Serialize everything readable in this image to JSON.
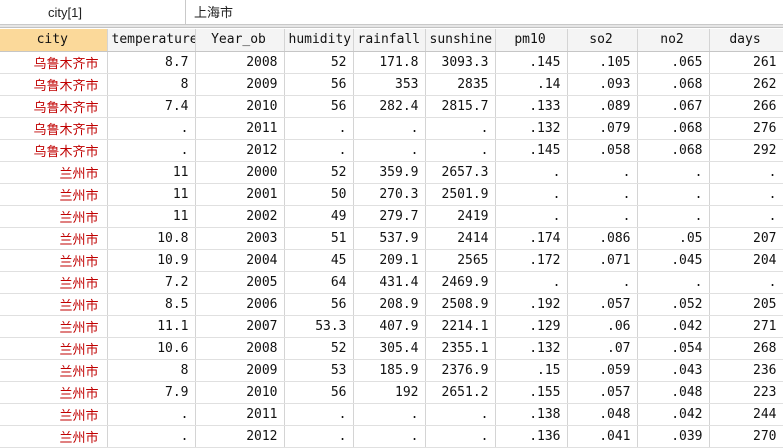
{
  "toolbar": {
    "cell_ref": "city[1]",
    "cell_value": "上海市"
  },
  "columns": [
    "city",
    "temperature",
    "Year_ob",
    "humidity",
    "rainfall",
    "sunshine",
    "pm10",
    "so2",
    "no2",
    "days"
  ],
  "rows": [
    [
      "乌鲁木齐市",
      "8.7",
      "2008",
      "52",
      "171.8",
      "3093.3",
      ".145",
      ".105",
      ".065",
      "261"
    ],
    [
      "乌鲁木齐市",
      "8",
      "2009",
      "56",
      "353",
      "2835",
      ".14",
      ".093",
      ".068",
      "262"
    ],
    [
      "乌鲁木齐市",
      "7.4",
      "2010",
      "56",
      "282.4",
      "2815.7",
      ".133",
      ".089",
      ".067",
      "266"
    ],
    [
      "乌鲁木齐市",
      ".",
      "2011",
      ".",
      ".",
      ".",
      ".132",
      ".079",
      ".068",
      "276"
    ],
    [
      "乌鲁木齐市",
      ".",
      "2012",
      ".",
      ".",
      ".",
      ".145",
      ".058",
      ".068",
      "292"
    ],
    [
      "兰州市",
      "11",
      "2000",
      "52",
      "359.9",
      "2657.3",
      ".",
      ".",
      ".",
      "."
    ],
    [
      "兰州市",
      "11",
      "2001",
      "50",
      "270.3",
      "2501.9",
      ".",
      ".",
      ".",
      "."
    ],
    [
      "兰州市",
      "11",
      "2002",
      "49",
      "279.7",
      "2419",
      ".",
      ".",
      ".",
      "."
    ],
    [
      "兰州市",
      "10.8",
      "2003",
      "51",
      "537.9",
      "2414",
      ".174",
      ".086",
      ".05",
      "207"
    ],
    [
      "兰州市",
      "10.9",
      "2004",
      "45",
      "209.1",
      "2565",
      ".172",
      ".071",
      ".045",
      "204"
    ],
    [
      "兰州市",
      "7.2",
      "2005",
      "64",
      "431.4",
      "2469.9",
      ".",
      ".",
      ".",
      "."
    ],
    [
      "兰州市",
      "8.5",
      "2006",
      "56",
      "208.9",
      "2508.9",
      ".192",
      ".057",
      ".052",
      "205"
    ],
    [
      "兰州市",
      "11.1",
      "2007",
      "53.3",
      "407.9",
      "2214.1",
      ".129",
      ".06",
      ".042",
      "271"
    ],
    [
      "兰州市",
      "10.6",
      "2008",
      "52",
      "305.4",
      "2355.1",
      ".132",
      ".07",
      ".054",
      "268"
    ],
    [
      "兰州市",
      "8",
      "2009",
      "53",
      "185.9",
      "2376.9",
      ".15",
      ".059",
      ".043",
      "236"
    ],
    [
      "兰州市",
      "7.9",
      "2010",
      "56",
      "192",
      "2651.2",
      ".155",
      ".057",
      ".048",
      "223"
    ],
    [
      "兰州市",
      ".",
      "2011",
      ".",
      ".",
      ".",
      ".138",
      ".048",
      ".042",
      "244"
    ],
    [
      "兰州市",
      ".",
      "2012",
      ".",
      ".",
      ".",
      ".136",
      ".041",
      ".039",
      "270"
    ]
  ],
  "colors": {
    "selected_header": "#fbd99a",
    "string_text": "#c00000"
  }
}
